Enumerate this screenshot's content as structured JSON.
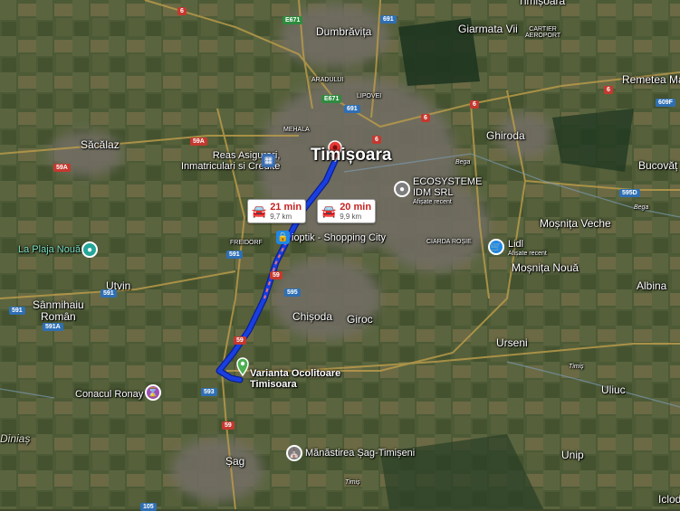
{
  "places": {
    "timisoara": "Timișoara",
    "dumbravita": "Dumbrăvița",
    "giarmata_vii": "Giarmata Vii",
    "timisoara_top": "Timișoara",
    "sacalaz": "Săcălaz",
    "ghiroda": "Ghiroda",
    "remetea_mare": "Remetea Mare",
    "bucovat": "Bucovăț",
    "mosnita_veche": "Moșnița Veche",
    "mosnita_noua": "Moșnița Nouă",
    "utvin": "Utvin",
    "sanmihaiu_roman": "Sânmihaiu\nRomân",
    "albina": "Albina",
    "chisoda": "Chișoda",
    "giroc": "Giroc",
    "urseni": "Urseni",
    "uliuc": "Uliuc",
    "sag": "Șag",
    "unip": "Unip",
    "iclod": "Iclod",
    "dinias": "Diniaș"
  },
  "small_labels": {
    "aradului": "ARADULUI",
    "lipovei": "LIPOVEI",
    "mehala": "MEHALA",
    "freidorf": "FREIDORF",
    "ciarda_rosie": "CIARDA ROȘIE",
    "cartier_aeroport": "CARTIER\nAEROPORT",
    "bega1": "Bega",
    "bega2": "Bega",
    "timis1": "Timiș",
    "timis2": "Timiș"
  },
  "pois": {
    "reas": "Reas Asigurari,\nInmatriculari si Credite",
    "ecosisteme": "ECOSYSTEME\nIDM SRL",
    "ecosisteme_sub": "Afișate recent",
    "optik": "ioptik - Shopping City",
    "plaja": "La Plaja Nouă",
    "lidl": "Lidl",
    "lidl_sub": "Afișate recent",
    "conacul": "Conacul Ronay",
    "varianta": "Varianta Ocolitoare\nTimisoara",
    "manastirea": "Mănăstirea Șag-Timișeni"
  },
  "route_options": [
    {
      "time": "21 min",
      "distance": "9,7 km",
      "color": "#c5221f"
    },
    {
      "time": "20 min",
      "distance": "9,9 km",
      "color": "#c5221f"
    }
  ],
  "shields": {
    "s6a": "6",
    "s6b": "6",
    "s6c": "6",
    "s6d": "6",
    "s6e": "6",
    "e671a": "E671",
    "e671b": "E671",
    "s691a": "691",
    "s691b": "691",
    "s59a": "59A",
    "s59b": "59A",
    "s595": "595",
    "s595d": "595D",
    "s609f": "609F",
    "s591a": "591",
    "s591b": "591",
    "s591c": "591",
    "s591d": "591A",
    "s59c": "59",
    "s59d": "59",
    "s59e": "59",
    "s593": "593",
    "s105": "105"
  },
  "colors": {
    "route": "#1a3fe0",
    "route_outline": "#0b1f8f",
    "destination_pin": "#e53935",
    "origin_pin": "#4caf50"
  }
}
